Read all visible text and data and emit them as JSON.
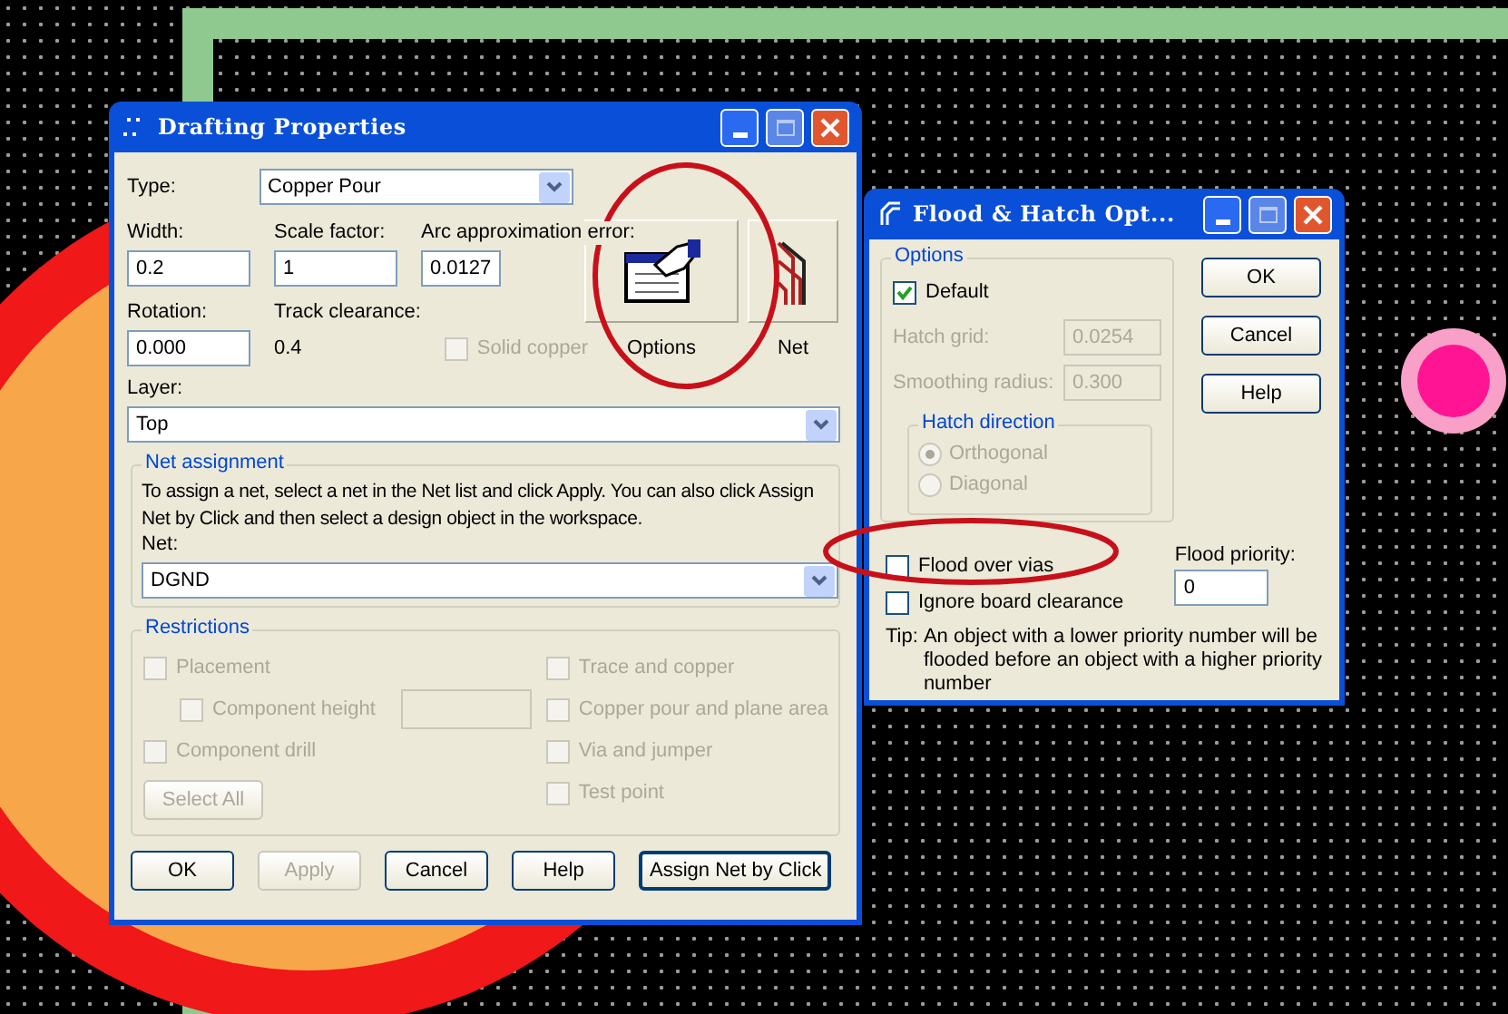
{
  "drafting_dialog": {
    "title": "Drafting Properties",
    "type": {
      "label": "Type:",
      "value": "Copper Pour"
    },
    "width": {
      "label": "Width:",
      "value": "0.2"
    },
    "scale_factor": {
      "label": "Scale factor:",
      "value": "1"
    },
    "arc_error": {
      "label": "Arc approximation error:",
      "value": "0.0127"
    },
    "rotation": {
      "label": "Rotation:",
      "value": "0.000"
    },
    "track_clearance": {
      "label": "Track clearance:",
      "value": "0.4"
    },
    "solid_copper": {
      "label": "Solid copper",
      "checked": false,
      "disabled": true
    },
    "tool_buttons": [
      {
        "label": "Options"
      },
      {
        "label": "Net"
      }
    ],
    "layer": {
      "label": "Layer:",
      "value": "Top"
    },
    "net_assignment": {
      "title": "Net assignment",
      "text": "To assign a net, select a net in the Net list and click Apply. You can also click Assign Net by Click and then select a design object in the workspace.",
      "net_label": "Net:",
      "net_value": "DGND"
    },
    "restrictions": {
      "title": "Restrictions",
      "left": [
        {
          "kind": "checkbox",
          "label": "Placement",
          "checked": false,
          "disabled": true
        },
        {
          "kind": "indented",
          "label": "Component height",
          "checked": false,
          "disabled": true
        },
        {
          "kind": "checkbox",
          "label": "Component drill",
          "checked": false,
          "disabled": true
        }
      ],
      "right": [
        {
          "label": "Trace and copper",
          "checked": false,
          "disabled": true
        },
        {
          "label": "Copper pour and plane area",
          "checked": false,
          "disabled": true
        },
        {
          "label": "Via and jumper",
          "checked": false,
          "disabled": true
        },
        {
          "label": "Test point",
          "checked": false,
          "disabled": true
        }
      ],
      "select_all": {
        "label": "Select All",
        "disabled": true
      }
    },
    "buttons": [
      {
        "label": "OK",
        "disabled": false
      },
      {
        "label": "Apply",
        "disabled": true
      },
      {
        "label": "Cancel",
        "disabled": false
      },
      {
        "label": "Help",
        "disabled": false
      },
      {
        "label": "Assign Net by Click",
        "disabled": false
      }
    ]
  },
  "flood_dialog": {
    "title": "Flood & Hatch Opt...",
    "options": {
      "title": "Options",
      "default": {
        "label": "Default",
        "checked": true
      },
      "hatch_grid": {
        "label": "Hatch grid:",
        "value": "0.0254",
        "disabled": true
      },
      "smoothing_radius": {
        "label": "Smoothing radius:",
        "value": "0.300",
        "disabled": true
      },
      "hatch_direction": {
        "title": "Hatch direction",
        "choices": [
          {
            "label": "Orthogonal",
            "selected": true,
            "disabled": true
          },
          {
            "label": "Diagonal",
            "selected": false,
            "disabled": true
          }
        ]
      }
    },
    "checks": [
      {
        "label": "Flood over vias",
        "checked": false
      },
      {
        "label": "Ignore board clearance",
        "checked": false
      }
    ],
    "flood_priority": {
      "label": "Flood priority:",
      "value": "0"
    },
    "tip": {
      "label": "Tip:",
      "text": "An object with a lower priority number will be flooded before an object with a higher priority number"
    },
    "buttons": [
      {
        "label": "OK"
      },
      {
        "label": "Cancel"
      },
      {
        "label": "Help"
      }
    ]
  }
}
